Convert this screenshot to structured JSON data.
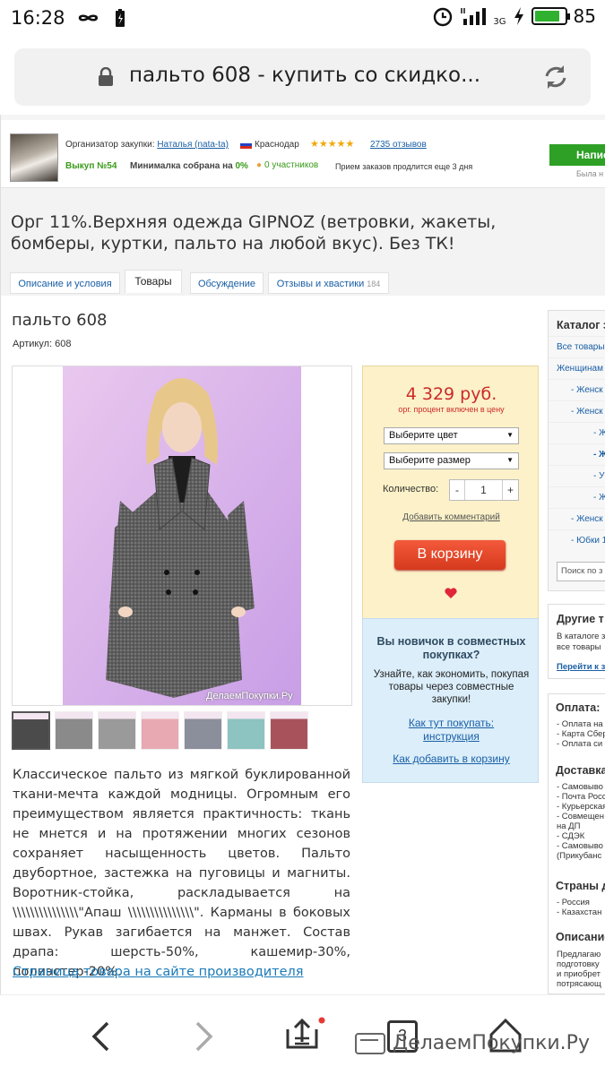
{
  "status_bar": {
    "time": "16:28",
    "network": "3G",
    "battery": "85"
  },
  "browser": {
    "url_title": "пальто 608 - купить со скидко..."
  },
  "organizer": {
    "label": "Организатор закупки:",
    "name": "Наталья (nata-ta)",
    "city": "Краснодар",
    "rating_stars": "★★★★★",
    "reviews": "2735 отзывов",
    "purchase_no": "Выкуп №54",
    "min_label": "Минималка собрана на",
    "min_value": "0%",
    "participants": "0 участников",
    "orders_until": "Прием заказов продлится еще 3 дня",
    "write_button": "Напис",
    "was_text": "Была н"
  },
  "purchase_title": "Орг 11%.Верхняя одежда GIPNOZ (ветровки, жакеты, бомберы, куртки, пальто на любой вкус). Без ТК!",
  "tabs": [
    {
      "label": "Описание и условия"
    },
    {
      "label": "Товары"
    },
    {
      "label": "Обсуждение"
    },
    {
      "label": "Отзывы и хвастики",
      "count": "184"
    }
  ],
  "product": {
    "title": "пальто 608",
    "article": "Артикул: 608",
    "photo_watermark": "ДелаемПокупки.Ру",
    "description": "Классическое пальто из мягкой буклированной ткани-мечта каждой модницы. Огромным его преимуществом является практичность: ткань не мнется и на протяжении многих сезонов сохраняет насыщенность цветов. Пальто двубортное, застежка на пуговицы и магниты. Воротник-стойка, раскладывается на \\\\\\\\\\\\\\\\\\\\\\\\\\\\\\\"Апаш \\\\\\\\\\\\\\\\\\\\\\\\\\\\\\\". Карманы в боковых швах. Рукав загибается на манжет. Состав драпа: шерсть-50%, кашемир-30%, полиэстер-20%.",
    "maker_link": "Страница товара на сайте производителя",
    "thumb_colors": [
      "#4b4b4b",
      "#8a8a8a",
      "#9a9a9a",
      "#e8a9b2",
      "#8b8f9c",
      "#8dc3c0",
      "#a8535b"
    ]
  },
  "buy": {
    "price": "4 329 руб.",
    "price_note": "орг. процент включен в цену",
    "color_select": "Выберите цвет",
    "size_select": "Выберите размер",
    "qty_label": "Количество:",
    "qty_minus": "-",
    "qty_value": "1",
    "qty_plus": "+",
    "comment_link": "Добавить комментарий",
    "cart_button": "В корзину"
  },
  "newbie": {
    "heading": "Вы новичок в совместных покупках?",
    "text": "Узнайте, как экономить, покупая товары через совместные закупки!",
    "link1": "Как тут покупать: инструкция",
    "link2": "Как добавить в корзину"
  },
  "catalog": {
    "heading": "Каталог з",
    "items": [
      "Все товары",
      "Женщинам",
      "- Женск",
      "- Женск",
      "- Ж",
      "- Ж",
      "- У",
      "- Ж",
      "- Женск",
      "- Юбки 1"
    ],
    "search_placeholder": "Поиск по з"
  },
  "other": {
    "heading": "Другие т",
    "lines": [
      "В каталоге з",
      "все товары"
    ],
    "link": "Перейти к з"
  },
  "payment": {
    "heading": "Оплата:",
    "lines": [
      "- Оплата на",
      "- Карта Сбер",
      "- Оплата си"
    ]
  },
  "delivery": {
    "heading": "Доставка",
    "lines": [
      "- Самовыво",
      "- Почта Росс",
      "- Курьерская",
      "- Совмещен",
      "на ДП",
      "- СДЭК",
      "- Самовыво",
      "(Прикубанс"
    ]
  },
  "countries": {
    "heading": "Страны д",
    "lines": [
      "- Россия",
      "- Казахстан"
    ]
  },
  "descr_side": {
    "heading": "Описание",
    "lines": [
      "Предлагаю",
      "подготовку",
      "и приобрет",
      "потрясающ"
    ]
  },
  "bottom": {
    "tab_count": "3",
    "watermark": "ДелаемПокупки.Ру"
  }
}
